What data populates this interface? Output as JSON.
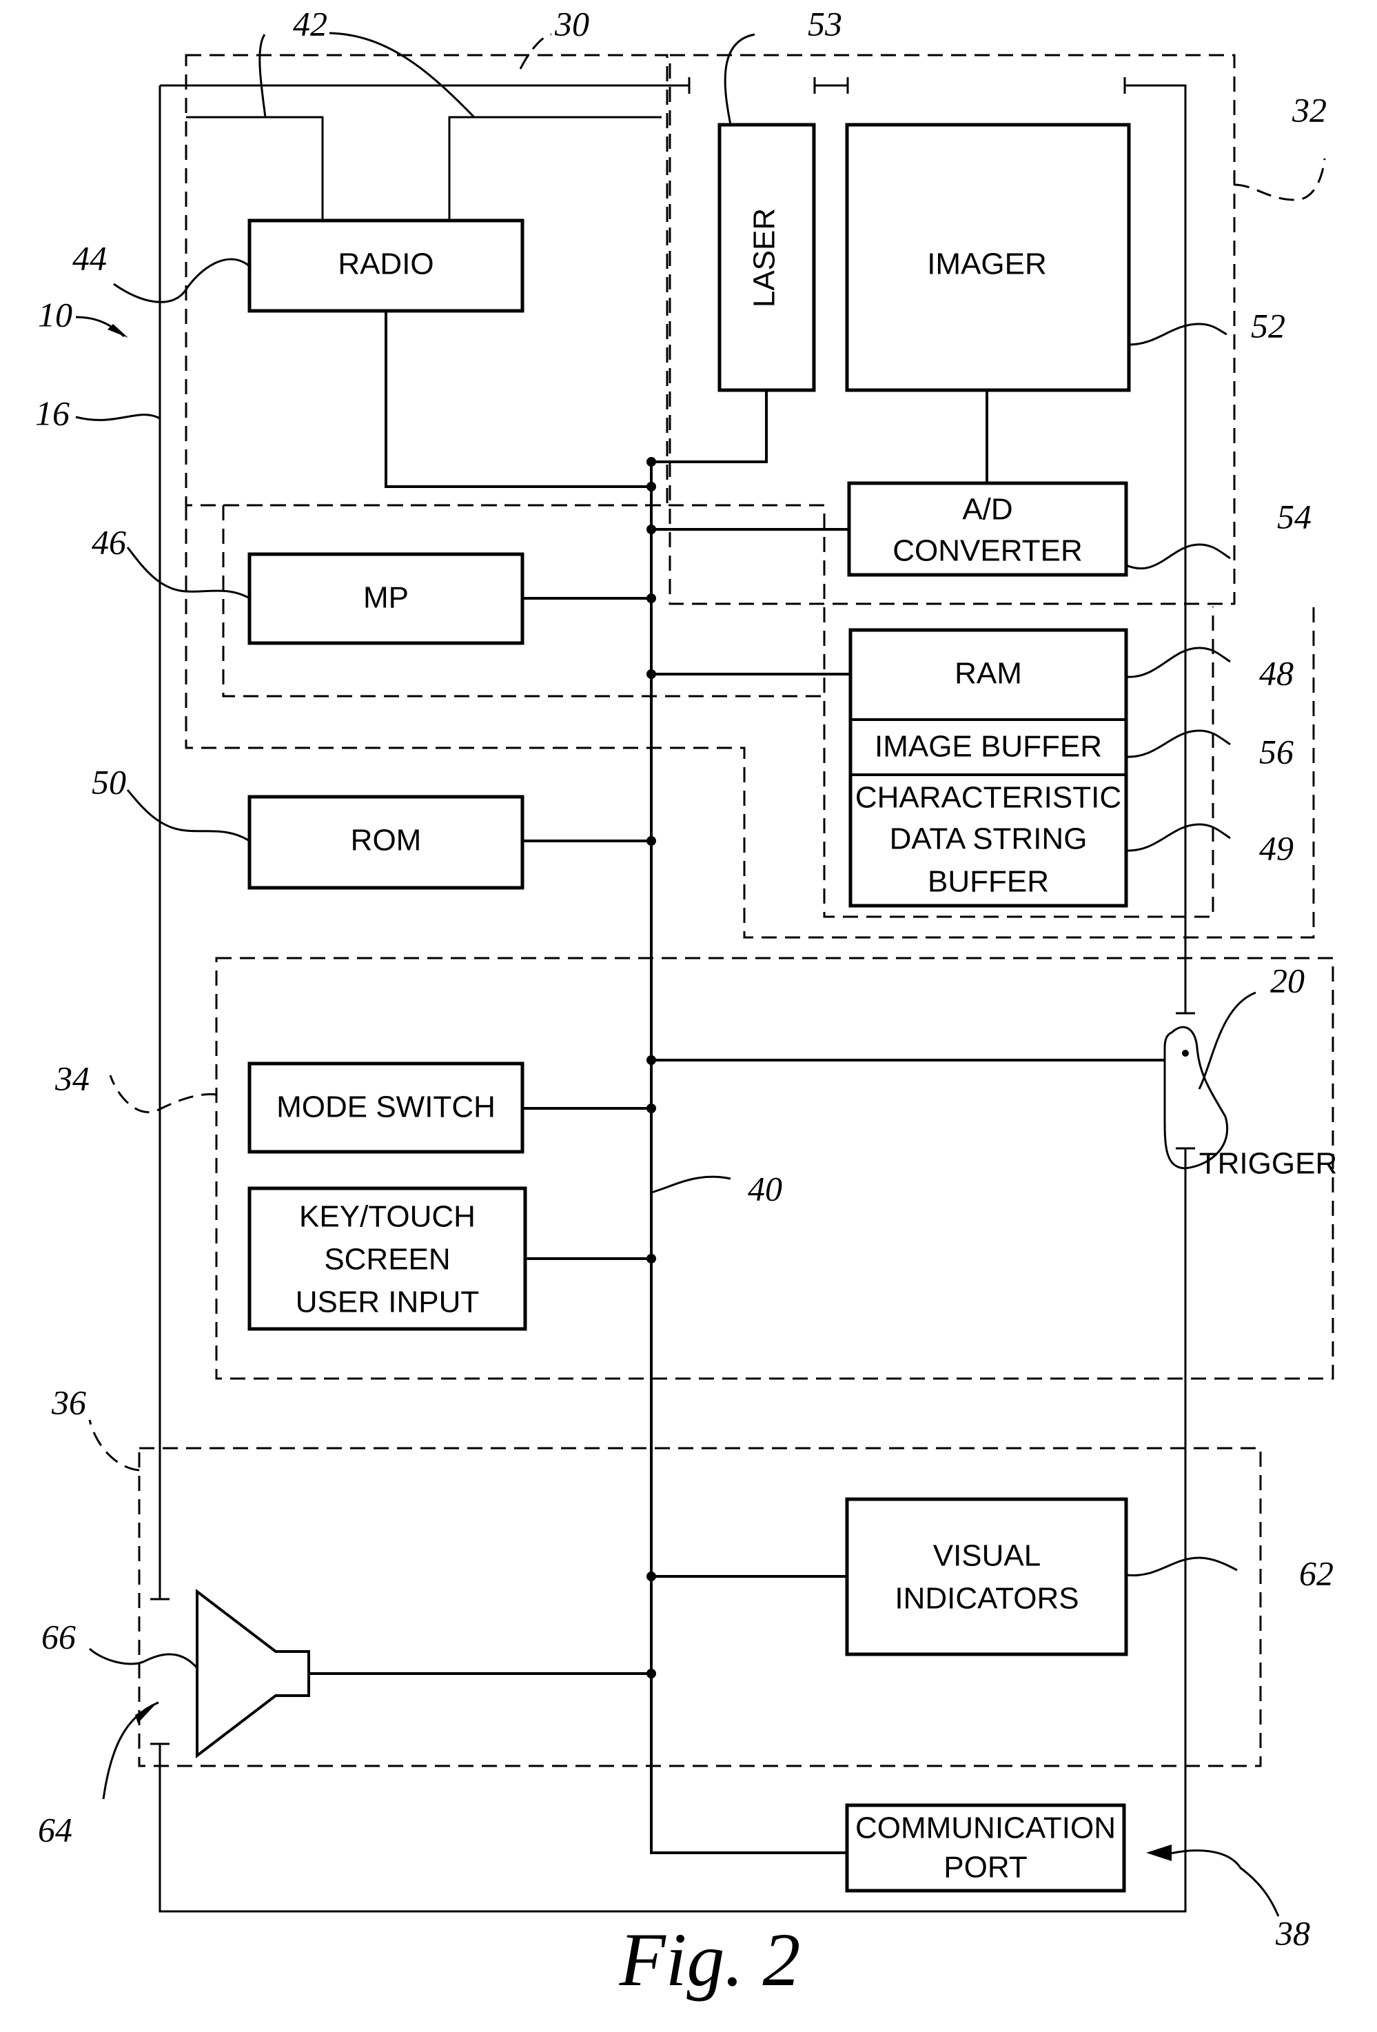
{
  "figure": {
    "caption": "Fig. 2",
    "overall_ref": "10"
  },
  "blocks": {
    "radio": {
      "label": "RADIO",
      "ref": "44"
    },
    "laser": {
      "label": "LASER",
      "ref": "53"
    },
    "imager": {
      "label": "IMAGER",
      "ref": "52"
    },
    "ad_converter": {
      "label_lines": [
        "A/D",
        "CONVERTER"
      ],
      "ref": "54"
    },
    "mp": {
      "label": "MP",
      "ref": "46"
    },
    "ram": {
      "label": "RAM",
      "ref": "48"
    },
    "image_buffer": {
      "label": "IMAGE BUFFER",
      "ref": "56"
    },
    "char_buffer": {
      "label_lines": [
        "CHARACTERISTIC",
        "DATA STRING",
        "BUFFER"
      ],
      "ref": "49"
    },
    "rom": {
      "label": "ROM",
      "ref": "50"
    },
    "mode_switch": {
      "label": "MODE SWITCH"
    },
    "key_touch": {
      "label_lines": [
        "KEY/TOUCH",
        "SCREEN",
        "USER INPUT"
      ]
    },
    "trigger": {
      "label": "TRIGGER",
      "ref": "20"
    },
    "visual_indicators": {
      "label_lines": [
        "VISUAL",
        "INDICATORS"
      ],
      "ref": "62"
    },
    "communication_port": {
      "label_lines": [
        "COMMUNICATION",
        "PORT"
      ],
      "ref": "38"
    },
    "speaker": {
      "ref_speaker": "66",
      "ref_sound": "64"
    }
  },
  "references": {
    "housing": "16",
    "antennas": "42",
    "radio_section": "30",
    "imaging_section": "32",
    "user_input_section": "34",
    "output_section": "36",
    "bus": "40"
  }
}
